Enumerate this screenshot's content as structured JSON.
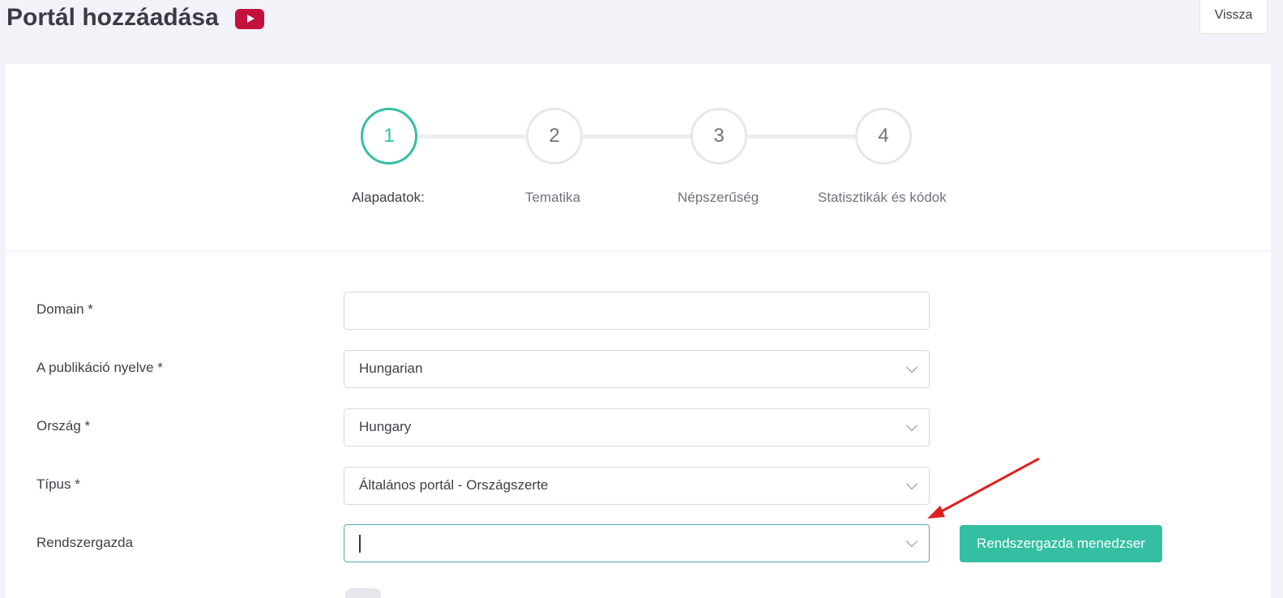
{
  "header": {
    "title": "Portál hozzáadása",
    "title_icon": "youtube-icon",
    "back_label": "Vissza"
  },
  "wizard": {
    "steps": [
      {
        "number": "1",
        "label": "Alapadatok:",
        "active": true
      },
      {
        "number": "2",
        "label": "Tematika",
        "active": false
      },
      {
        "number": "3",
        "label": "Népszerűség",
        "active": false
      },
      {
        "number": "4",
        "label": "Statisztikák és kódok",
        "active": false
      }
    ]
  },
  "form": {
    "domain": {
      "label": "Domain *",
      "value": ""
    },
    "language": {
      "label": "A publikáció nyelve *",
      "value": "Hungarian"
    },
    "country": {
      "label": "Ország *",
      "value": "Hungary"
    },
    "type": {
      "label": "Típus *",
      "value": "Általános portál - Országszerte"
    },
    "admin": {
      "label": "Rendszergazda",
      "value": ""
    },
    "admin_manager_label": "Rendszergazda menedzser"
  },
  "colors": {
    "accent": "#34bfa3",
    "brand_icon": "#c4123d",
    "annotation_arrow": "#e02020"
  }
}
